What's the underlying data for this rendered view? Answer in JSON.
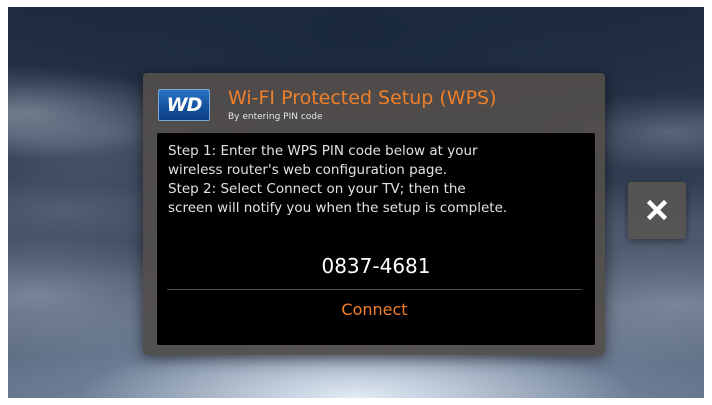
{
  "dialog": {
    "logo_text": "WD",
    "title": "Wi-FI Protected Setup (WPS)",
    "subtitle": "By entering PIN code",
    "instructions": [
      "Step 1: Enter the WPS PIN code below at your",
      "wireless router's web configuration page.",
      "Step 2: Select Connect on your TV; then the",
      "screen will notify you when the setup is complete."
    ],
    "pin_code": "0837-4681",
    "connect_label": "Connect"
  },
  "close_button": {
    "icon": "close-icon"
  },
  "colors": {
    "accent_orange": "#f07f2a",
    "logo_blue": "#1553a0",
    "panel_background": "#000000"
  }
}
